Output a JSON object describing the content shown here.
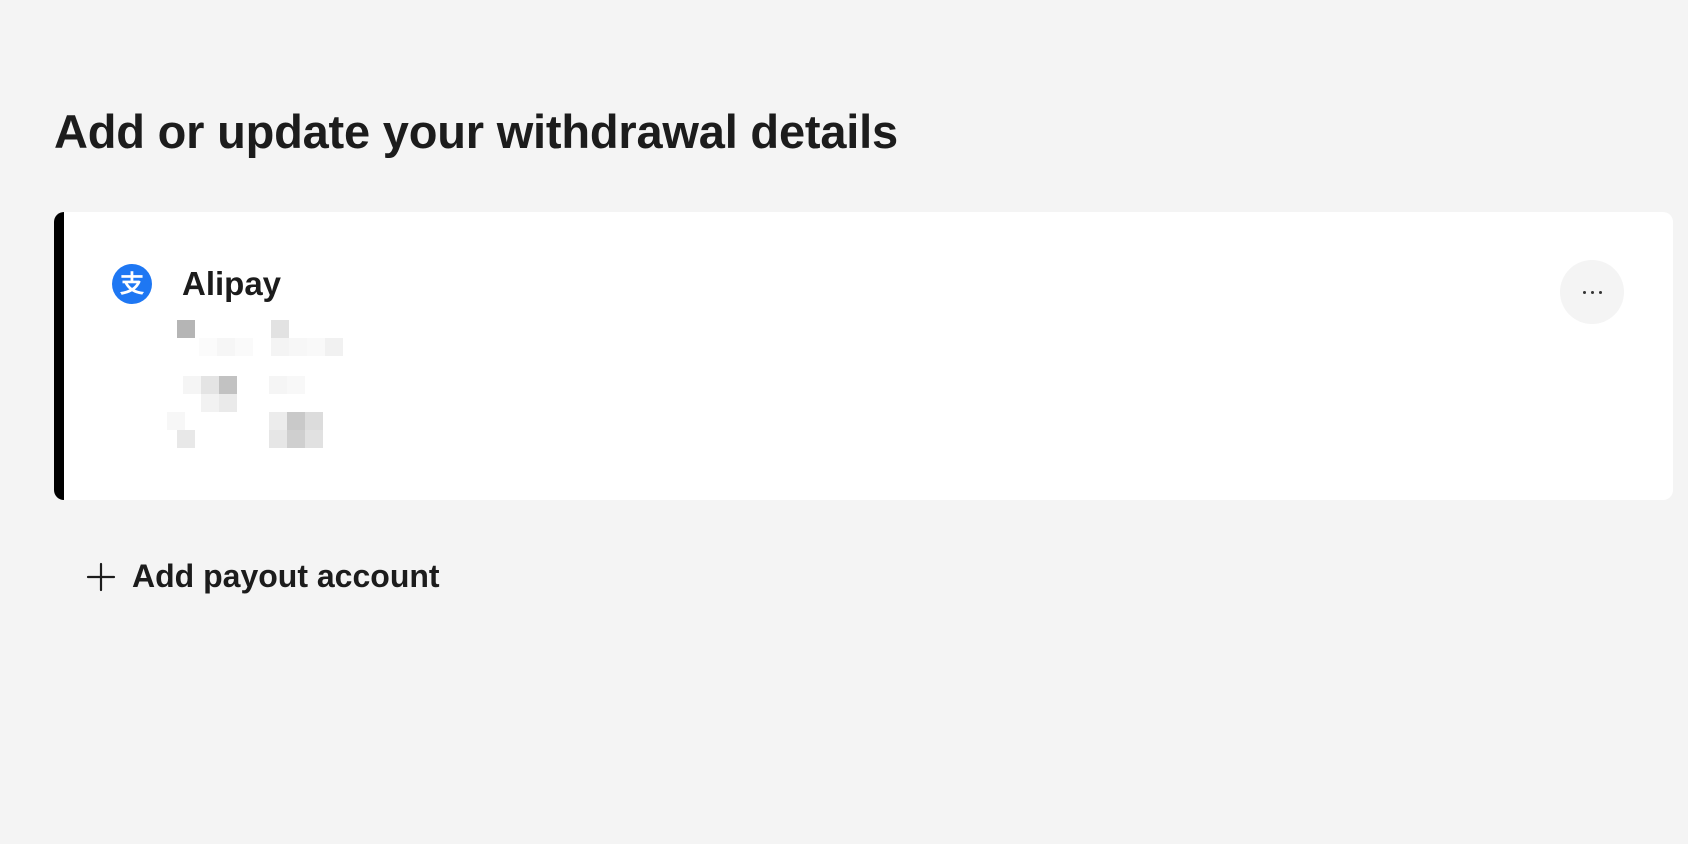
{
  "page": {
    "title": "Add or update your withdrawal details"
  },
  "account": {
    "provider_name": "Alipay",
    "logo_glyph": "支",
    "logo_icon": "alipay-logo-icon",
    "brand_color": "#1e77f3",
    "details_redacted": true,
    "more_options_icon": "ellipsis-icon",
    "more_options_glyph": "..."
  },
  "actions": {
    "add_payout_label": "Add payout account",
    "add_payout_icon": "plus-icon"
  },
  "colors": {
    "background": "#f4f4f4",
    "card": "#ffffff",
    "card_accent": "#000000",
    "text": "#1c1c1c"
  }
}
